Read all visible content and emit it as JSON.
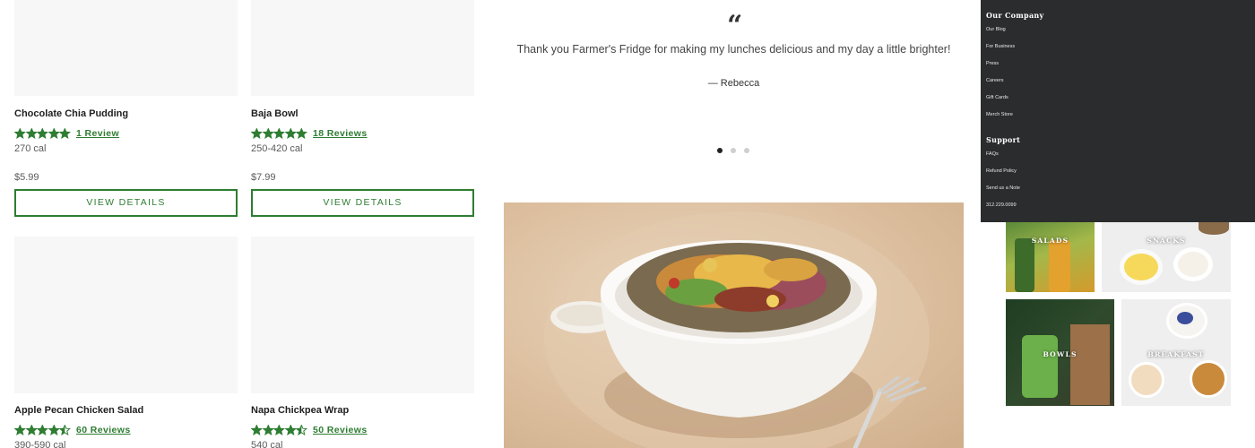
{
  "products": [
    {
      "name": "Chocolate Chia Pudding",
      "rating": 5,
      "reviews": "1 Review",
      "calories": "270 cal",
      "price": "$5.99",
      "button": "VIEW DETAILS"
    },
    {
      "name": "Baja Bowl",
      "rating": 5,
      "reviews": "18 Reviews",
      "calories": "250-420 cal",
      "price": "$7.99",
      "button": "VIEW DETAILS"
    },
    {
      "name": "Apple Pecan Chicken Salad",
      "rating": 4.5,
      "reviews": "60 Reviews",
      "calories": "390-590 cal"
    },
    {
      "name": "Napa Chickpea Wrap",
      "rating": 4.5,
      "reviews": "50 Reviews",
      "calories": "540 cal"
    }
  ],
  "testimonial": {
    "quote_icon": "quote-icon",
    "text": "Thank you Farmer's Fridge for making my lunches delicious and my day a little brighter!",
    "author": "— Rebecca",
    "active_slide": 1,
    "slide_count": 3
  },
  "categories": [
    {
      "label": "SALADS"
    },
    {
      "label": "SNACKS"
    },
    {
      "label": "BOWLS"
    },
    {
      "label": "BREAKFAST"
    }
  ],
  "footer_menu": {
    "company_heading": "Our Company",
    "company_links": [
      "Our Blog",
      "For Business",
      "Press",
      "Careers",
      "Gift Cards",
      "Merch Store"
    ],
    "support_heading": "Support",
    "support_links": [
      "FAQs",
      "Refund Policy",
      "Send us a Note",
      "312.229.0099"
    ]
  },
  "colors": {
    "accent_green": "#2e7d32",
    "menu_background": "#2b2c2e",
    "placeholder_gray": "#f7f7f7"
  }
}
